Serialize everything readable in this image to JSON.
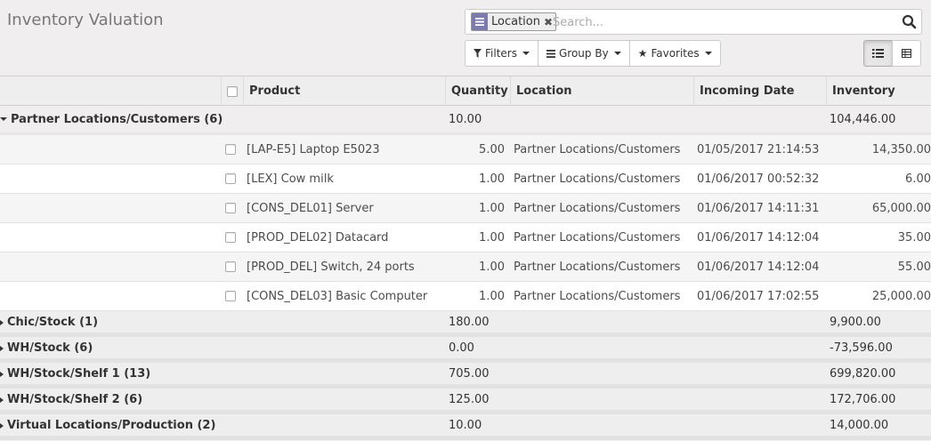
{
  "page": {
    "title": "Inventory Valuation"
  },
  "search": {
    "facet_label": "Location",
    "placeholder": "Search..."
  },
  "toolbar": {
    "filters": "Filters",
    "group_by": "Group By",
    "favorites": "Favorites"
  },
  "columns": {
    "product": "Product",
    "quantity": "Quantity",
    "location": "Location",
    "incoming_date": "Incoming Date",
    "inventory_value": "Inventory Value"
  },
  "expanded_group": {
    "label": "Partner Locations/Customers (6)",
    "quantity": "10.00",
    "value": "104,446.00",
    "rows": [
      {
        "product": "[LAP-E5] Laptop E5023",
        "quantity": "5.00",
        "location": "Partner Locations/Customers",
        "date": "01/05/2017 21:14:53",
        "value": "14,350.00"
      },
      {
        "product": "[LEX] Cow milk",
        "quantity": "1.00",
        "location": "Partner Locations/Customers",
        "date": "01/06/2017 00:52:32",
        "value": "6.00"
      },
      {
        "product": "[CONS_DEL01] Server",
        "quantity": "1.00",
        "location": "Partner Locations/Customers",
        "date": "01/06/2017 14:11:31",
        "value": "65,000.00"
      },
      {
        "product": "[PROD_DEL02] Datacard",
        "quantity": "1.00",
        "location": "Partner Locations/Customers",
        "date": "01/06/2017 14:12:04",
        "value": "35.00"
      },
      {
        "product": "[PROD_DEL] Switch, 24 ports",
        "quantity": "1.00",
        "location": "Partner Locations/Customers",
        "date": "01/06/2017 14:12:04",
        "value": "55.00"
      },
      {
        "product": "[CONS_DEL03] Basic Computer",
        "quantity": "1.00",
        "location": "Partner Locations/Customers",
        "date": "01/06/2017 17:02:55",
        "value": "25,000.00"
      }
    ]
  },
  "groups": [
    {
      "label": "Chic/Stock (1)",
      "quantity": "180.00",
      "value": "9,900.00"
    },
    {
      "label": "WH/Stock (6)",
      "quantity": "0.00",
      "value": "-73,596.00"
    },
    {
      "label": "WH/Stock/Shelf 1 (13)",
      "quantity": "705.00",
      "value": "699,820.00"
    },
    {
      "label": "WH/Stock/Shelf 2 (6)",
      "quantity": "125.00",
      "value": "172,706.00"
    },
    {
      "label": "Virtual Locations/Production (2)",
      "quantity": "10.00",
      "value": "14,000.00"
    }
  ]
}
